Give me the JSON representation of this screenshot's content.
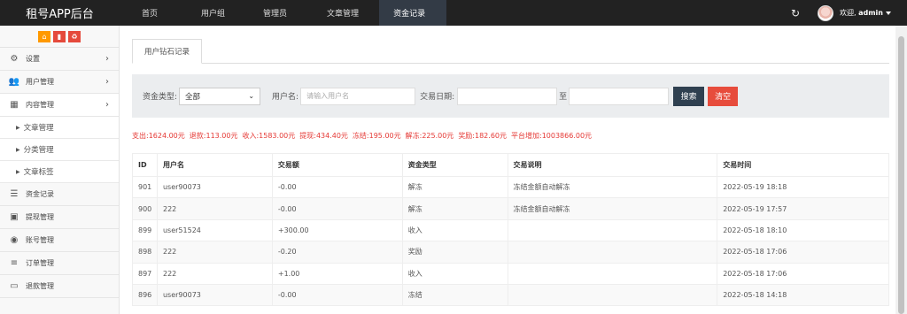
{
  "brand": "租号APP后台",
  "nav": [
    {
      "label": "首页",
      "active": false
    },
    {
      "label": "用户组",
      "active": false
    },
    {
      "label": "管理员",
      "active": false
    },
    {
      "label": "文章管理",
      "active": false
    },
    {
      "label": "资金记录",
      "active": true
    }
  ],
  "user": {
    "welcome": "欢迎,",
    "name": "admin"
  },
  "sidebar": {
    "items": [
      {
        "label": "设置",
        "icon": "gears-icon",
        "has_arrow": true
      },
      {
        "label": "用户管理",
        "icon": "users-icon",
        "has_arrow": true
      },
      {
        "label": "内容管理",
        "icon": "grid-icon",
        "has_arrow": true
      },
      {
        "label": "资金记录",
        "icon": "list-icon",
        "has_arrow": false
      },
      {
        "label": "提现管理",
        "icon": "money-icon",
        "has_arrow": false
      },
      {
        "label": "账号管理",
        "icon": "gamepad-icon",
        "has_arrow": false
      },
      {
        "label": "订单管理",
        "icon": "bars-icon",
        "has_arrow": false
      },
      {
        "label": "退款管理",
        "icon": "desktop-icon",
        "has_arrow": false
      }
    ],
    "sub_items": [
      "文章管理",
      "分类管理",
      "文章标签"
    ]
  },
  "tab": "用户钻石记录",
  "filter": {
    "type_label": "资金类型:",
    "type_value": "全部",
    "username_label": "用户名:",
    "username_placeholder": "请输入用户名",
    "date_label": "交易日期:",
    "to_label": "至",
    "search_button": "搜索",
    "clear_button": "清空"
  },
  "summary": [
    "支出:1624.00元",
    "退款:113.00元",
    "收入:1583.00元",
    "提现:434.40元",
    "冻结:195.00元",
    "解冻:225.00元",
    "奖励:182.60元",
    "平台增加:1003866.00元"
  ],
  "table": {
    "headers": [
      "ID",
      "用户名",
      "交易额",
      "资金类型",
      "交易说明",
      "交易时间"
    ],
    "rows": [
      [
        "901",
        "user90073",
        "-0.00",
        "解冻",
        "冻结金额自动解冻",
        "2022-05-19 18:18"
      ],
      [
        "900",
        "222",
        "-0.00",
        "解冻",
        "冻结金额自动解冻",
        "2022-05-19 17:57"
      ],
      [
        "899",
        "user51524",
        "+300.00",
        "收入",
        "",
        "2022-05-18 18:10"
      ],
      [
        "898",
        "222",
        "-0.20",
        "奖励",
        "",
        "2022-05-18 17:06"
      ],
      [
        "897",
        "222",
        "+1.00",
        "收入",
        "",
        "2022-05-18 17:06"
      ],
      [
        "896",
        "user90073",
        "-0.00",
        "冻结",
        "",
        "2022-05-18 14:18"
      ]
    ]
  },
  "colors": {
    "navbar": "#222222",
    "nav_active": "#333b46",
    "summary_text": "#e53935",
    "search_button": "#2f4050",
    "clear_button": "#e74c3c"
  }
}
